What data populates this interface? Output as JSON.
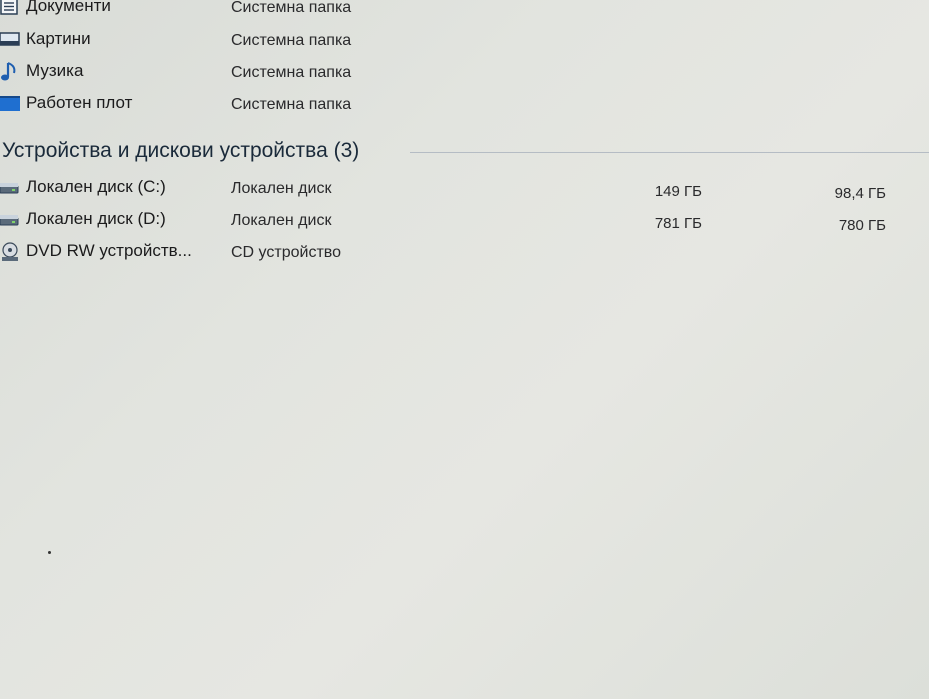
{
  "folders": [
    {
      "name": "Документи",
      "type": "Системна папка",
      "icon": "documents-icon"
    },
    {
      "name": "Картини",
      "type": "Системна папка",
      "icon": "pictures-icon"
    },
    {
      "name": "Музика",
      "type": "Системна папка",
      "icon": "music-icon"
    },
    {
      "name": "Работен плот",
      "type": "Системна папка",
      "icon": "desktop-icon"
    }
  ],
  "devices_group": {
    "title": "Устройства и дискови устройства (3)"
  },
  "devices": [
    {
      "name": "Локален диск (C:)",
      "type": "Локален диск",
      "total": "149 ГБ",
      "free": "98,4 ГБ",
      "icon": "drive-icon"
    },
    {
      "name": "Локален диск (D:)",
      "type": "Локален диск",
      "total": "781 ГБ",
      "free": "780 ГБ",
      "icon": "drive-icon"
    },
    {
      "name": "DVD RW устройств...",
      "type": "CD устройство",
      "icon": "dvd-drive-icon"
    }
  ],
  "colors": {
    "background": "#e2e4df",
    "text": "#1d1d1f",
    "group_title": "#1a2a3a",
    "divider": "#b5bcc4",
    "icon_blue": "#1f5fb0"
  }
}
